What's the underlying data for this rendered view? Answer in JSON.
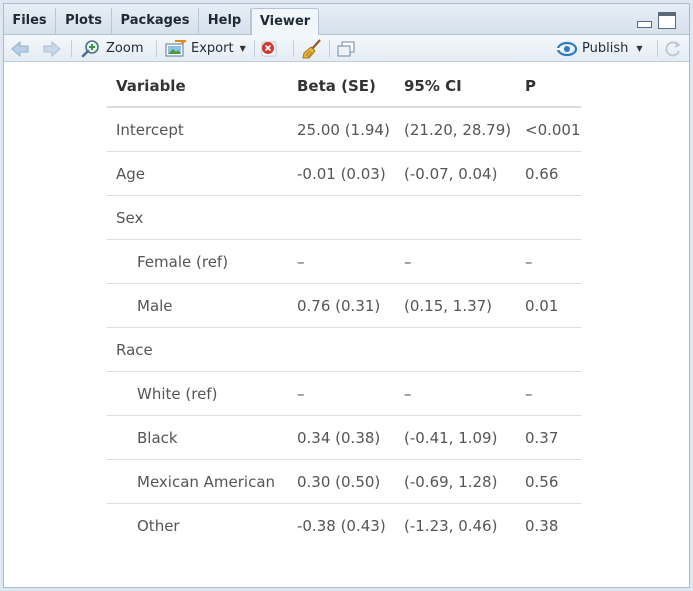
{
  "tabs": [
    {
      "label": "Files",
      "active": false
    },
    {
      "label": "Plots",
      "active": false
    },
    {
      "label": "Packages",
      "active": false
    },
    {
      "label": "Help",
      "active": false
    },
    {
      "label": "Viewer",
      "active": true
    }
  ],
  "toolbar": {
    "zoom_label": "Zoom",
    "export_label": "Export",
    "publish_label": "Publish"
  },
  "table": {
    "headers": [
      "Variable",
      "Beta (SE)",
      "95% CI",
      "P"
    ],
    "rows": [
      {
        "variable": "Intercept",
        "beta": "25.00 (1.94)",
        "ci": "(21.20, 28.79)",
        "p": "<0.001",
        "indent": false
      },
      {
        "variable": "Age",
        "beta": "-0.01 (0.03)",
        "ci": "(-0.07, 0.04)",
        "p": "0.66",
        "indent": false
      },
      {
        "variable": "Sex",
        "beta": "",
        "ci": "",
        "p": "",
        "indent": false
      },
      {
        "variable": "Female (ref)",
        "beta": "–",
        "ci": "–",
        "p": "–",
        "indent": true
      },
      {
        "variable": "Male",
        "beta": "0.76 (0.31)",
        "ci": "(0.15, 1.37)",
        "p": "0.01",
        "indent": true
      },
      {
        "variable": "Race",
        "beta": "",
        "ci": "",
        "p": "",
        "indent": false
      },
      {
        "variable": "White (ref)",
        "beta": "–",
        "ci": "–",
        "p": "–",
        "indent": true
      },
      {
        "variable": "Black",
        "beta": "0.34 (0.38)",
        "ci": "(-0.41, 1.09)",
        "p": "0.37",
        "indent": true
      },
      {
        "variable": "Mexican American",
        "beta": "0.30 (0.50)",
        "ci": "(-0.69, 1.28)",
        "p": "0.56",
        "indent": true
      },
      {
        "variable": "Other",
        "beta": "-0.38 (0.43)",
        "ci": "(-1.23, 0.46)",
        "p": "0.38",
        "indent": true
      }
    ]
  },
  "icons": [
    "back-arrow-icon",
    "forward-arrow-icon",
    "zoom-icon",
    "export-icon",
    "clear-icon",
    "broom-icon",
    "popout-icon",
    "publish-icon",
    "refresh-icon"
  ],
  "colors": {
    "accent": "#2f7bbf",
    "clear_red": "#d9342b",
    "text": "#333333"
  }
}
